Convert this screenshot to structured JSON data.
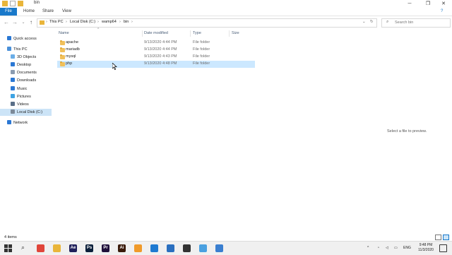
{
  "window": {
    "title": "bin"
  },
  "ribbon": {
    "tabs": [
      "File",
      "Home",
      "Share",
      "View"
    ]
  },
  "address": {
    "crumbs": [
      "This PC",
      "Local Disk (C:)",
      "wamp64",
      "bin"
    ],
    "search_placeholder": "Search bin"
  },
  "nav": {
    "items": [
      {
        "label": "Quick access",
        "icon": "star-icon",
        "color": "#2b78d4"
      },
      {
        "label": "This PC",
        "icon": "computer-icon",
        "color": "#4a90d9"
      },
      {
        "label": "3D Objects",
        "icon": "cube-icon",
        "color": "#6aaee8"
      },
      {
        "label": "Desktop",
        "icon": "desktop-icon",
        "color": "#2b78d4"
      },
      {
        "label": "Documents",
        "icon": "document-icon",
        "color": "#8a9bb0"
      },
      {
        "label": "Downloads",
        "icon": "download-icon",
        "color": "#2b78d4"
      },
      {
        "label": "Music",
        "icon": "music-icon",
        "color": "#2b78d4"
      },
      {
        "label": "Pictures",
        "icon": "pictures-icon",
        "color": "#3da3e3"
      },
      {
        "label": "Videos",
        "icon": "video-icon",
        "color": "#5a6f88"
      },
      {
        "label": "Local Disk (C:)",
        "icon": "drive-icon",
        "color": "#7c8a99"
      },
      {
        "label": "Network",
        "icon": "network-icon",
        "color": "#2b78d4"
      }
    ]
  },
  "columns": {
    "name": "Name",
    "date": "Date modified",
    "type": "Type",
    "size": "Size"
  },
  "files": [
    {
      "name": "apache",
      "date": "9/13/2020 4:44 PM",
      "type": "File folder"
    },
    {
      "name": "mariadb",
      "date": "9/13/2020 4:44 PM",
      "type": "File folder"
    },
    {
      "name": "mysql",
      "date": "9/13/2020 4:43 PM",
      "type": "File folder"
    },
    {
      "name": "php",
      "date": "9/13/2020 4:48 PM",
      "type": "File folder"
    }
  ],
  "preview": {
    "message": "Select a file to preview."
  },
  "status": {
    "count": "4 items"
  },
  "tray": {
    "lang": "ENG",
    "time": "9:48 PM",
    "date": "11/3/2020"
  },
  "taskbar_apps": [
    {
      "name": "chrome-icon",
      "color": "#e0453a",
      "glyph": ""
    },
    {
      "name": "file-explorer-icon",
      "color": "#e9b53a",
      "glyph": ""
    },
    {
      "name": "after-effects-icon",
      "color": "#1f1f5a",
      "glyph": "Ae"
    },
    {
      "name": "photoshop-icon",
      "color": "#0b1f3a",
      "glyph": "Ps"
    },
    {
      "name": "premiere-icon",
      "color": "#1f0f3a",
      "glyph": "Pr"
    },
    {
      "name": "illustrator-icon",
      "color": "#3a1a0a",
      "glyph": "Ai"
    },
    {
      "name": "sublime-text-icon",
      "color": "#f09a2a",
      "glyph": ""
    },
    {
      "name": "vscode-icon",
      "color": "#1f7ad1",
      "glyph": ""
    },
    {
      "name": "media-app-icon",
      "color": "#2a6fbf",
      "glyph": ""
    },
    {
      "name": "record-app-icon",
      "color": "#333333",
      "glyph": ""
    },
    {
      "name": "remote-app-icon",
      "color": "#4aa0e0",
      "glyph": ""
    },
    {
      "name": "network-app-icon",
      "color": "#3a7fd0",
      "glyph": ""
    }
  ]
}
